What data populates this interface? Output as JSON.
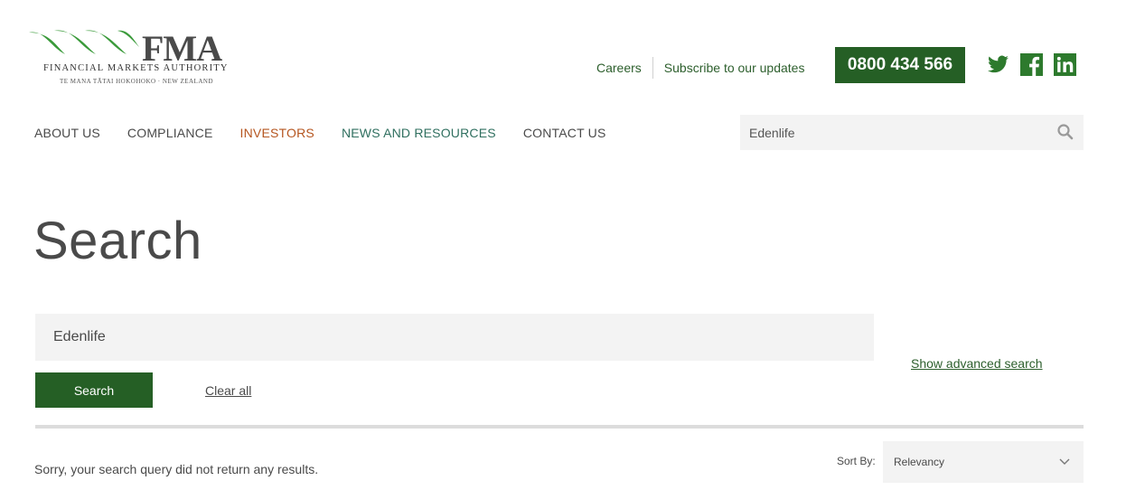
{
  "brand": {
    "wordmark": "FMA",
    "name": "FINANCIAL MARKETS AUTHORITY",
    "tagline": "TE MANA TĀTAI HOKOHOKO · NEW ZEALAND",
    "logo_color": "#3a9a3a"
  },
  "utility": {
    "careers": "Careers",
    "subscribe": "Subscribe to our updates",
    "phone": "0800 434 566"
  },
  "social": [
    "twitter-icon",
    "facebook-icon",
    "linkedin-icon"
  ],
  "nav": {
    "items": [
      {
        "label": "ABOUT US"
      },
      {
        "label": "COMPLIANCE"
      },
      {
        "label": "INVESTORS"
      },
      {
        "label": "NEWS AND RESOURCES"
      },
      {
        "label": "CONTACT US"
      }
    ]
  },
  "header_search": {
    "value": "Edenlife"
  },
  "page": {
    "title": "Search"
  },
  "search": {
    "value": "Edenlife",
    "button_label": "Search",
    "clear_label": "Clear all",
    "advanced_label": "Show advanced search"
  },
  "results": {
    "message": "Sorry, your search query did not return any results.",
    "sort_label": "Sort By:",
    "sort_value": "Relevancy"
  },
  "colors": {
    "brand_green": "#255f25",
    "link_green": "#2d5f2d",
    "investors_orange": "#b5551f",
    "field_bg": "#f3f3f3"
  }
}
